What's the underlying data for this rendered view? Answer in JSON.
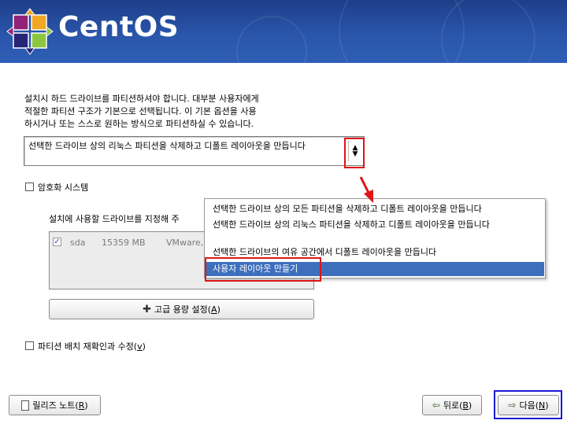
{
  "header": {
    "brand": "CentOS",
    "colors": {
      "background": "#2a55aa",
      "logo_purple": "#932279",
      "logo_green": "#8cc63f",
      "logo_orange": "#efa724",
      "logo_blue": "#262577"
    }
  },
  "intro_text": "설치시 하드 드라이브를 파티션하셔야 합니다. 대부분 사용자에게\n적절한 파티션 구조가 기본으로 선택됩니다. 이 기본 옵션을 사용\n하시거나 또는 스스로 원하는 방식으로 파티션하실 수 있습니다.",
  "partition_combo": {
    "selected": "선택한 드라이브 상의 리눅스 파티션을 삭제하고 디폴트 레이아웃을 만듭니다",
    "options": [
      "선택한 드라이브 상의 모든 파티션을 삭제하고 디폴트 레이아웃을 만듭니다",
      "선택한 드라이브 상의 리눅스 파티션을 삭제하고 디폴트 레이아웃을 만듭니다",
      "선택한 드라이브의 여유 공간에서 디폴트 레이아웃을 만듭니다",
      "사용자 레이아웃 만들기"
    ],
    "highlighted_index": 3
  },
  "encrypt_checkbox": {
    "label": "암호화 시스템",
    "checked": false
  },
  "drive_select_label": "설치에 사용할 드라이브를 지정해 주",
  "drives": [
    {
      "name": "sda",
      "size": "15359 MB",
      "model": "VMware,",
      "checked": true
    }
  ],
  "advanced_button": {
    "label": "고급 용량 설정(",
    "mnemonic": "A",
    "suffix": ")"
  },
  "review_checkbox": {
    "label": "파티션 배치 재확인과 수정(",
    "mnemonic": "v",
    "suffix": ")",
    "checked": false
  },
  "footer": {
    "release_notes": {
      "label": "릴리즈 노트(",
      "mnemonic": "R",
      "suffix": ")"
    },
    "back": {
      "label": "뒤로(",
      "mnemonic": "B",
      "suffix": ")"
    },
    "next": {
      "label": "다음(",
      "mnemonic": "N",
      "suffix": ")"
    }
  },
  "annotation_colors": {
    "red": "#e01515",
    "blue": "#1a1ad0"
  }
}
